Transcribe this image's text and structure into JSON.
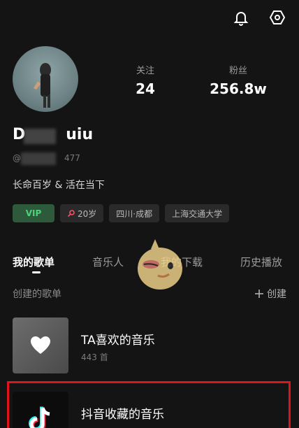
{
  "icons": {
    "notification": "bell-icon",
    "settings": "gear-icon",
    "heart": "heart-icon",
    "app_logo": "douyin-logo-icon"
  },
  "profile": {
    "name_prefix": "D",
    "name_suffix": "uiu",
    "handle_prefix": "@",
    "handle_suffix": "477",
    "bio": "长命百岁 & 活在当下"
  },
  "stats": [
    {
      "label": "关注",
      "value": "24"
    },
    {
      "label": "粉丝",
      "value": "256.8w"
    }
  ],
  "tags": [
    {
      "label": "VIP"
    },
    {
      "label": "20岁"
    },
    {
      "label": "四川·成都"
    },
    {
      "label": "上海交通大学"
    }
  ],
  "tabs": [
    {
      "label": "我的歌单"
    },
    {
      "label": "音乐人"
    },
    {
      "label": "我的下载"
    },
    {
      "label": "历史播放"
    }
  ],
  "section": {
    "title": "创建的歌单",
    "create_label": "创建"
  },
  "playlists": [
    {
      "title": "TA喜欢的音乐",
      "count": "443 首"
    },
    {
      "title": "抖音收藏的音乐",
      "count": ""
    }
  ],
  "colors": {
    "accent_green": "#4fd27c",
    "highlight_red": "#e0151b",
    "background": "#141414"
  }
}
